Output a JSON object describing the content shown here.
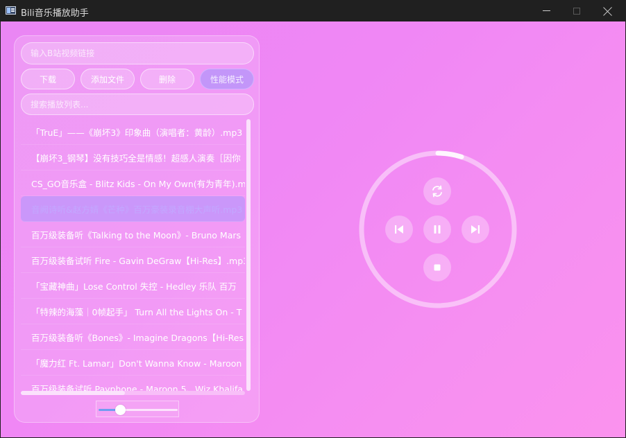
{
  "window": {
    "title": "Bili音乐播放助手"
  },
  "panel": {
    "url_placeholder": "输入B站视频链接",
    "buttons": {
      "download": "下载",
      "add_file": "添加文件",
      "delete": "删除",
      "performance_mode": "性能模式"
    },
    "search_placeholder": "搜索播放列表...",
    "playlist": [
      "「TruE」——《崩坏3》印象曲（演唱者：黄龄）.mp3",
      "【崩坏3_钢琴】没有技巧全是情感！超感人演奏［因你",
      "CS_GO音乐盒 - Blitz Kids - On My Own(有为青年).mp3",
      "音阙诗听&赵方婧《芒种》百万豪装录音棚大声听.mp3",
      "百万级装备听《Talking to the Moon》- Bruno Mars",
      "百万级装备试听 Fire - Gavin DeGraw【Hi-Res】.mp3",
      "「宝藏神曲」Lose Control 失控 - Hedley 乐队  百万",
      "「特辣的海藻｜0帧起手」 Turn All the Lights On - T",
      "百万级装备听《Bones》- Imagine Dragons【Hi-Res",
      "「魔力红 Ft. Lamar」Don't Wanna Know - Maroon",
      "百万级装备试听 Payphone - Maroon 5、Wiz Khalifa"
    ],
    "selected_index": 3,
    "volume": 0.28
  },
  "player": {
    "progress": 0.05,
    "icons": {
      "loop": "loop-icon",
      "prev": "skip-previous-icon",
      "pause": "pause-icon",
      "next": "skip-next-icon",
      "stop": "stop-icon"
    }
  },
  "colors": {
    "accent": "#c89cfb",
    "volume_fill": "#6f9df0"
  }
}
